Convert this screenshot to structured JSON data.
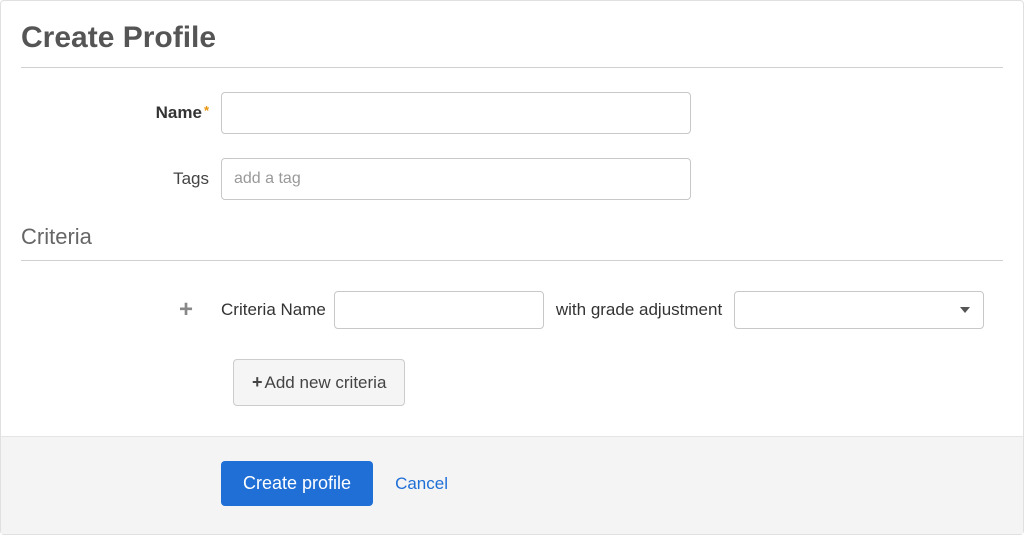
{
  "page": {
    "title": "Create Profile"
  },
  "form": {
    "name_label": "Name",
    "name_value": "",
    "tags_label": "Tags",
    "tags_placeholder": "add a tag",
    "tags_value": ""
  },
  "criteria": {
    "section_title": "Criteria",
    "name_label": "Criteria Name",
    "name_value": "",
    "grade_label": "with grade adjustment",
    "grade_value": "",
    "add_button_label": "Add new criteria"
  },
  "footer": {
    "submit_label": "Create profile",
    "cancel_label": "Cancel"
  }
}
